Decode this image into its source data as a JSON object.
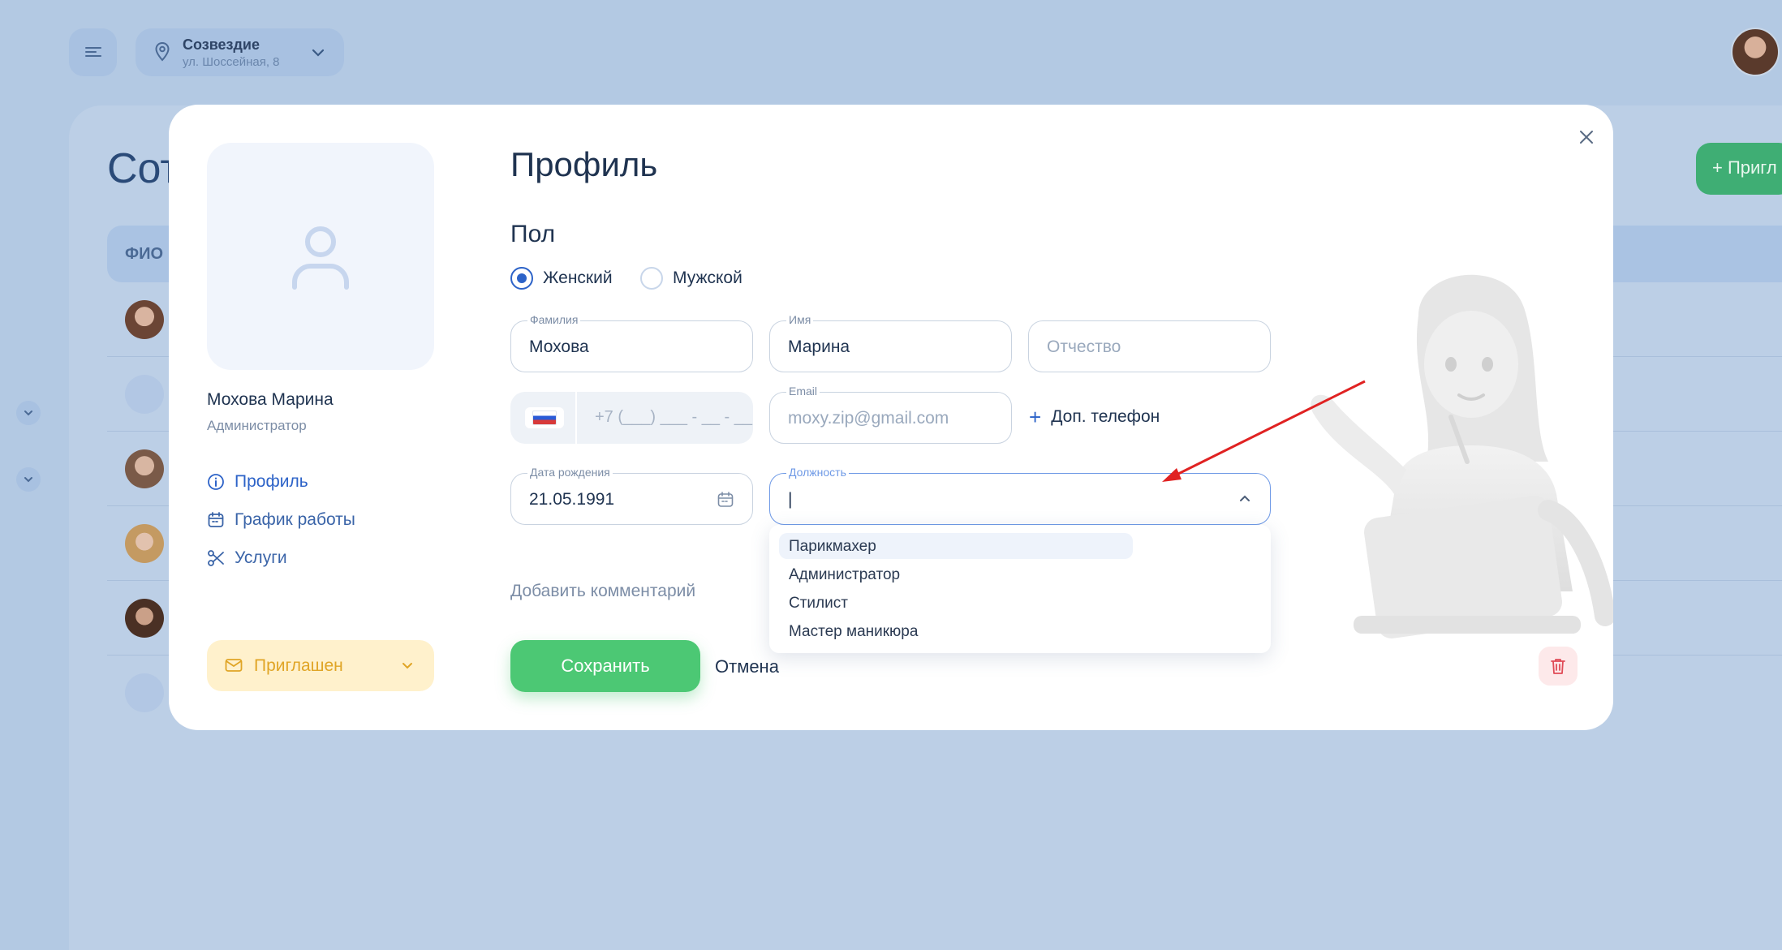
{
  "topbar": {
    "location_name": "Созвездие",
    "location_address": "ул. Шоссейная, 8"
  },
  "background": {
    "page_title": "Сот",
    "table_header": "ФИО",
    "invite_label": "+ Пригл"
  },
  "modal": {
    "title": "Профиль",
    "employee_name": "Мохова Марина",
    "employee_role": "Администратор",
    "nav": [
      {
        "label": "Профиль",
        "icon": "info-icon",
        "active": true
      },
      {
        "label": "График работы",
        "icon": "calendar-icon",
        "active": false
      },
      {
        "label": "Услуги",
        "icon": "scissors-icon",
        "active": false
      }
    ],
    "status_label": "Приглашен",
    "gender": {
      "title": "Пол",
      "options": [
        {
          "label": "Женский",
          "selected": true
        },
        {
          "label": "Мужской",
          "selected": false
        }
      ]
    },
    "fields": {
      "last_name": {
        "label": "Фамилия",
        "value": "Мохова"
      },
      "first_name": {
        "label": "Имя",
        "value": "Марина"
      },
      "middle_name": {
        "placeholder": "Отчество"
      },
      "phone": {
        "placeholder": "+7 (___) ___ - __ - __"
      },
      "email": {
        "label": "Email",
        "placeholder": "moxy.zip@gmail.com"
      },
      "birth_date": {
        "label": "Дата рождения",
        "value": "21.05.1991"
      },
      "position": {
        "label": "Должность",
        "value": "|"
      }
    },
    "add_phone_label": "Доп. телефон",
    "position_options": [
      "Парикмахер",
      "Администратор",
      "Стилист",
      "Мастер маникюра"
    ],
    "add_comment_label": "Добавить комментарий",
    "save_label": "Сохранить",
    "cancel_label": "Отмена"
  },
  "colors": {
    "accent_blue": "#2d63c8",
    "save_green": "#4cc874",
    "status_yellow": "#e0a526",
    "delete_red": "#e04b57"
  }
}
